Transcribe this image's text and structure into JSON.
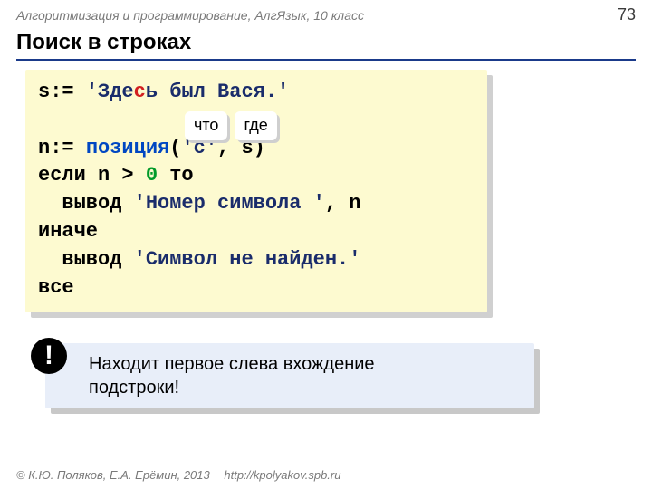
{
  "header": {
    "breadcrumb": "Алгоритмизация и программирование, АлгЯзык, 10 класс",
    "page": "73"
  },
  "title": "Поиск в строках",
  "code": {
    "l1": {
      "a": "s:= ",
      "b": "'Зде",
      "c": "с",
      "d": "ь был Вася.'"
    },
    "l2": {
      "a": "n:= ",
      "b": "позиция",
      "c": "(",
      "d": "'с'",
      "e": ", s)"
    },
    "l3": {
      "a": "если n > ",
      "b": "0",
      "c": " то"
    },
    "l4": {
      "a": "  вывод ",
      "b": "'Номер символа '",
      "c": ", n"
    },
    "l5": "иначе",
    "l6": {
      "a": "  вывод ",
      "b": "'Символ не найден.'"
    },
    "l7": "все"
  },
  "chips": {
    "what": "что",
    "where": "где"
  },
  "note": {
    "bang": "!",
    "line1": "Находит первое слева вхождение",
    "line2": "подстроки!"
  },
  "footer": {
    "copyright": "© К.Ю. Поляков, Е.А. Ерёмин, 2013",
    "url": "http://kpolyakov.spb.ru"
  }
}
